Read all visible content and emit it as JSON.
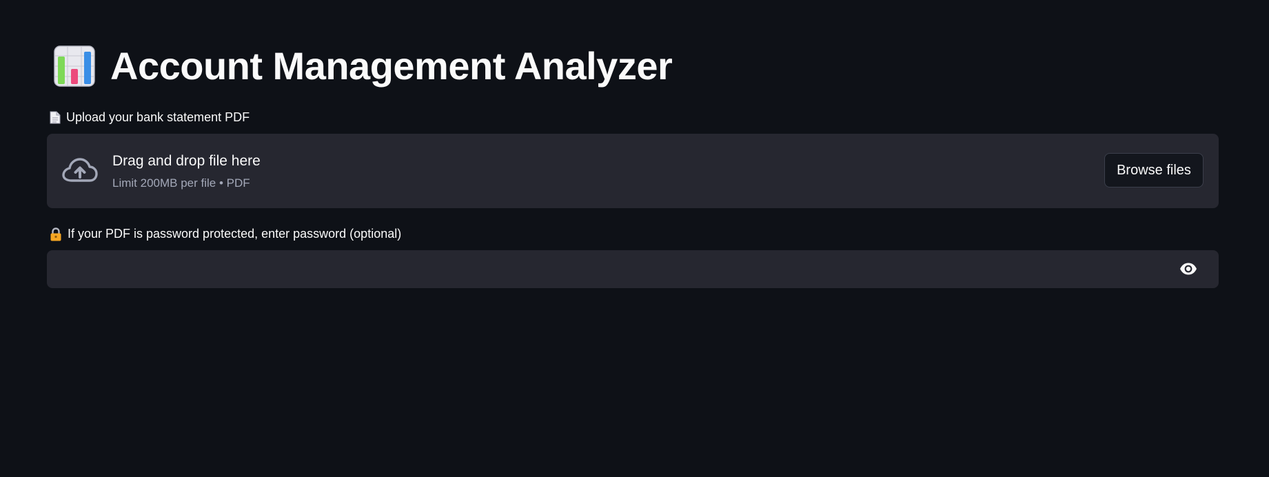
{
  "header": {
    "title_icon": "bar-chart-emoji-icon",
    "title": "Account Management Analyzer"
  },
  "upload": {
    "label_icon": "page-facing-up-emoji-icon",
    "label": "Upload your bank statement PDF",
    "dropzone_icon": "cloud-upload-icon",
    "dropzone_title": "Drag and drop file here",
    "dropzone_limit": "Limit 200MB per file • PDF",
    "browse_label": "Browse files"
  },
  "password": {
    "label_icon": "lock-emoji-icon",
    "label": "If your PDF is password protected, enter password (optional)",
    "value": "",
    "toggle_icon": "eye-icon"
  },
  "colors": {
    "background": "#0e1117",
    "surface": "#262730",
    "text": "#fafafa",
    "muted": "#a3a8b8"
  }
}
